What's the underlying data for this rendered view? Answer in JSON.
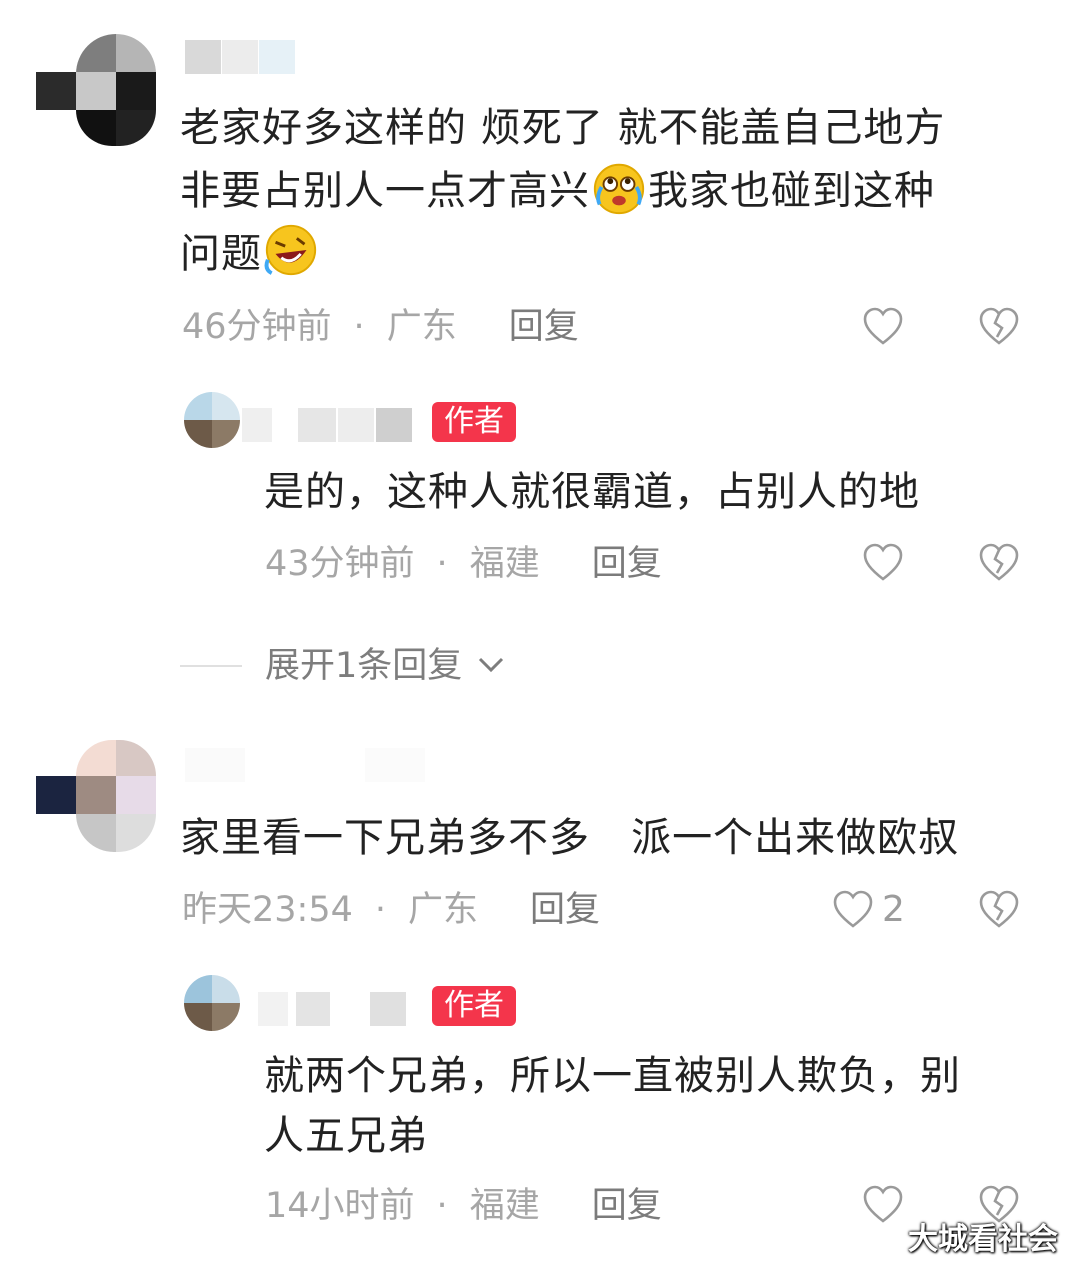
{
  "comments": [
    {
      "text_line1": "老家好多这样的 烦死了 就不能盖自己地方",
      "text_line2": "非要占别人一点才高兴",
      "text_line2_emoji": "crying-laughing-emoji",
      "text_line2_after": "我家也碰到这种",
      "text_line3": "问题",
      "text_line3_emoji": "rolling-laughing-emoji",
      "time": "46分钟前",
      "location": "广东",
      "reply_label": "回复",
      "reply": {
        "badge": "作者",
        "text_line1": "是的，这种人就很霸道，占别人的地",
        "time": "43分钟前",
        "location": "福建",
        "reply_label": "回复"
      },
      "expand_label": "展开1条回复"
    },
    {
      "text_line1": "家里看一下兄弟多不多   派一个出来做欧叔",
      "time": "昨天23:54",
      "location": "广东",
      "reply_label": "回复",
      "like_count": "2",
      "reply": {
        "badge": "作者",
        "text_line1": "就两个兄弟，所以一直被别人欺负，别",
        "text_line2": "人五兄弟",
        "time": "14小时前",
        "location": "福建",
        "reply_label": "回复"
      }
    }
  ],
  "separator": "·",
  "watermark": "大城看社会",
  "colors": {
    "badge": "#f4354b",
    "meta": "#a6a6a6",
    "text": "#222222"
  }
}
